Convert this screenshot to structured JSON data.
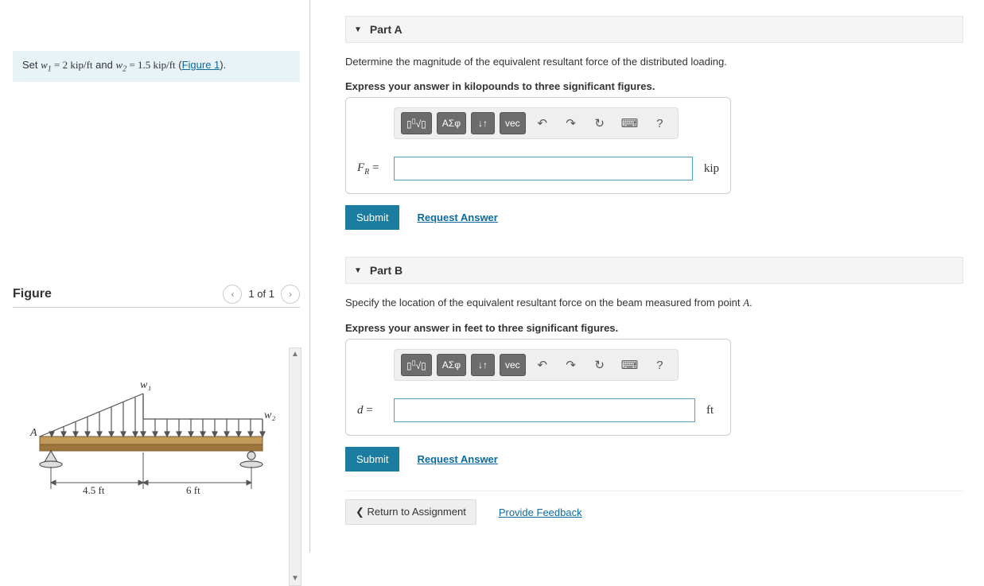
{
  "left": {
    "set_prefix": "Set ",
    "w1_var": "w",
    "w1_sub": "1",
    "w1_eq": " = 2 kip/ft",
    "and": " and ",
    "w2_var": "w",
    "w2_sub": "2",
    "w2_eq": " = 1.5 kip/ft",
    "fig_paren_open": " (",
    "fig_link": "Figure 1",
    "fig_paren_close": ").",
    "figure_title": "Figure",
    "figure_count": "1 of 1",
    "diagram": {
      "w1_label": "w₁",
      "w2_label": "w₂",
      "A_label": "A",
      "dim1": "4.5 ft",
      "dim2": "6 ft"
    }
  },
  "partA": {
    "title": "Part A",
    "prompt": "Determine the magnitude of the equivalent resultant force of the distributed loading.",
    "instr": "Express your answer in kilopounds to three significant figures.",
    "toolbar": {
      "templates": "√x",
      "greek": "ΑΣφ",
      "subsup": "↓↑",
      "vec": "vec",
      "undo": "↶",
      "redo": "↷",
      "reset": "↻",
      "keyboard": "⌨",
      "help": "?"
    },
    "var_html": "F",
    "var_sub": "R",
    "eq": " = ",
    "unit": "kip",
    "submit": "Submit",
    "request": "Request Answer"
  },
  "partB": {
    "title": "Part B",
    "prompt_pre": "Specify the location of the equivalent resultant force on the beam measured from point ",
    "prompt_A": "A",
    "prompt_post": ".",
    "instr": "Express your answer in feet to three significant figures.",
    "var": "d",
    "eq": " = ",
    "unit": "ft",
    "submit": "Submit",
    "request": "Request Answer"
  },
  "footer": {
    "return": "Return to Assignment",
    "feedback": "Provide Feedback"
  }
}
